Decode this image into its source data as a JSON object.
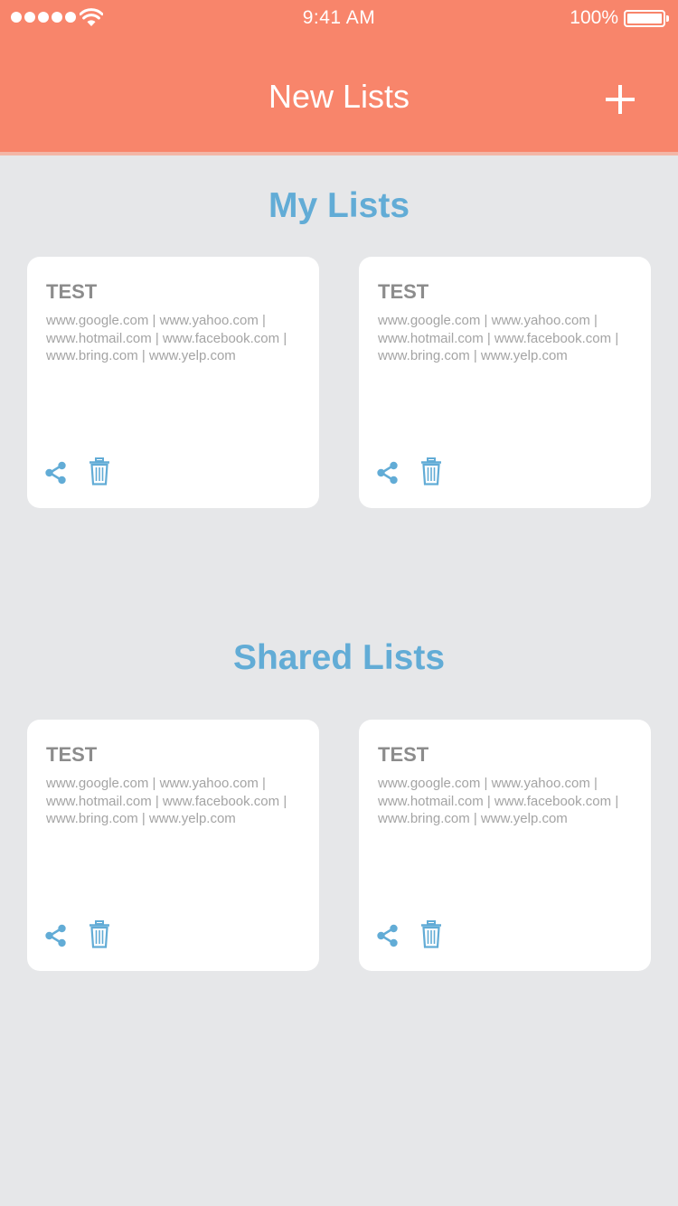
{
  "status_bar": {
    "time": "9:41 AM",
    "battery": "100%"
  },
  "header": {
    "title": "New Lists",
    "add_icon": "plus-icon"
  },
  "my_lists": {
    "title": "My Lists",
    "cards": [
      {
        "title": "TEST",
        "links": "www.google.com  |  www.yahoo.com  |  www.hotmail.com  |  www.facebook.com  |  www.bring.com  |  www.yelp.com"
      },
      {
        "title": "TEST",
        "links": "www.google.com  |  www.yahoo.com  |  www.hotmail.com  |  www.facebook.com  |  www.bring.com  |  www.yelp.com"
      }
    ]
  },
  "shared_lists": {
    "title": "Shared Lists",
    "cards": [
      {
        "title": "TEST",
        "links": "www.google.com  |  www.yahoo.com  |  www.hotmail.com  |  www.facebook.com  |  www.bring.com  |  www.yelp.com"
      },
      {
        "title": "TEST",
        "links": "www.google.com  |  www.yahoo.com  |  www.hotmail.com  |  www.facebook.com  |  www.bring.com  |  www.yelp.com"
      }
    ]
  },
  "colors": {
    "header": "#f8856b",
    "accent": "#62acd6",
    "background": "#e6e7e9"
  },
  "icons": {
    "share": "share-icon",
    "delete": "trash-icon"
  }
}
